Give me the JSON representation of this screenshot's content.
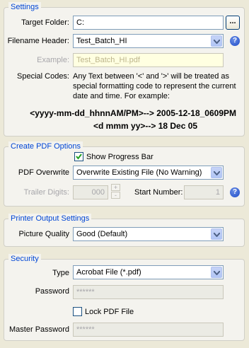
{
  "settings": {
    "title": "Settings",
    "target_folder_label": "Target Folder:",
    "target_folder_value": "C:",
    "browse_label": "...",
    "filename_header_label": "Filename Header:",
    "filename_header_value": "Test_Batch_HI",
    "example_label": "Example:",
    "example_value": "Test_Batch_HI.pdf",
    "special_codes_label": "Special Codes:",
    "special_codes_text": "Any Text between '<' and '>' will be treated as special formatting code to represent the current date and time. For example:",
    "example1": "<yyyy-mm-dd_hhnnAM/PM>--> 2005-12-18_0609PM",
    "example2": "<d mmm yy>--> 18 Dec 05"
  },
  "pdf_options": {
    "title": "Create PDF Options",
    "show_progress_label": "Show Progress Bar",
    "show_progress_checked": true,
    "overwrite_label": "PDF Overwrite",
    "overwrite_value": "Overwrite Existing File (No Warning)",
    "trailer_digits_label": "Trailer Digits:",
    "trailer_digits_value": "000",
    "start_number_label": "Start Number:",
    "start_number_value": "1"
  },
  "printer_output": {
    "title": "Printer Output Settings",
    "quality_label": "Picture Quality",
    "quality_value": "Good (Default)"
  },
  "security": {
    "title": "Security",
    "type_label": "Type",
    "type_value": "Acrobat File (*.pdf)",
    "password_label": "Password",
    "password_value": "******",
    "lock_label": "Lock PDF File",
    "lock_checked": false,
    "master_password_label": "Master Password",
    "master_password_value": "******"
  },
  "help_icon_text": "?"
}
